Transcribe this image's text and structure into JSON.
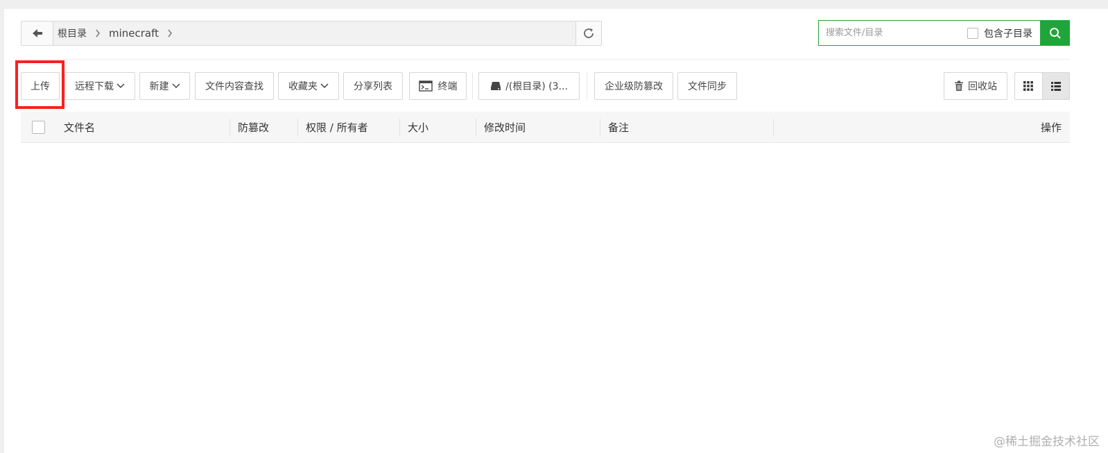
{
  "breadcrumb": {
    "items": [
      "根目录",
      "minecraft"
    ]
  },
  "search": {
    "placeholder": "搜索文件/目录",
    "include_subdir_label": "包含子目录"
  },
  "toolbar": {
    "upload": "上传",
    "remote_download": "远程下载",
    "new": "新建",
    "content_search": "文件内容查找",
    "favorites": "收藏夹",
    "share_list": "分享列表",
    "terminal": "终端",
    "disk": "/(根目录) (3...",
    "tamper_proof": "企业级防篡改",
    "file_sync": "文件同步",
    "recycle_bin": "回收站"
  },
  "table": {
    "columns": {
      "name": "文件名",
      "tamper": "防篡改",
      "perm_owner": "权限 / 所有者",
      "size": "大小",
      "mtime": "修改时间",
      "remark": "备注",
      "actions": "操作"
    },
    "rows": []
  },
  "watermark": "@稀土掘金技术社区",
  "colors": {
    "accent": "#20a53a",
    "highlight": "#ff1f1f"
  }
}
